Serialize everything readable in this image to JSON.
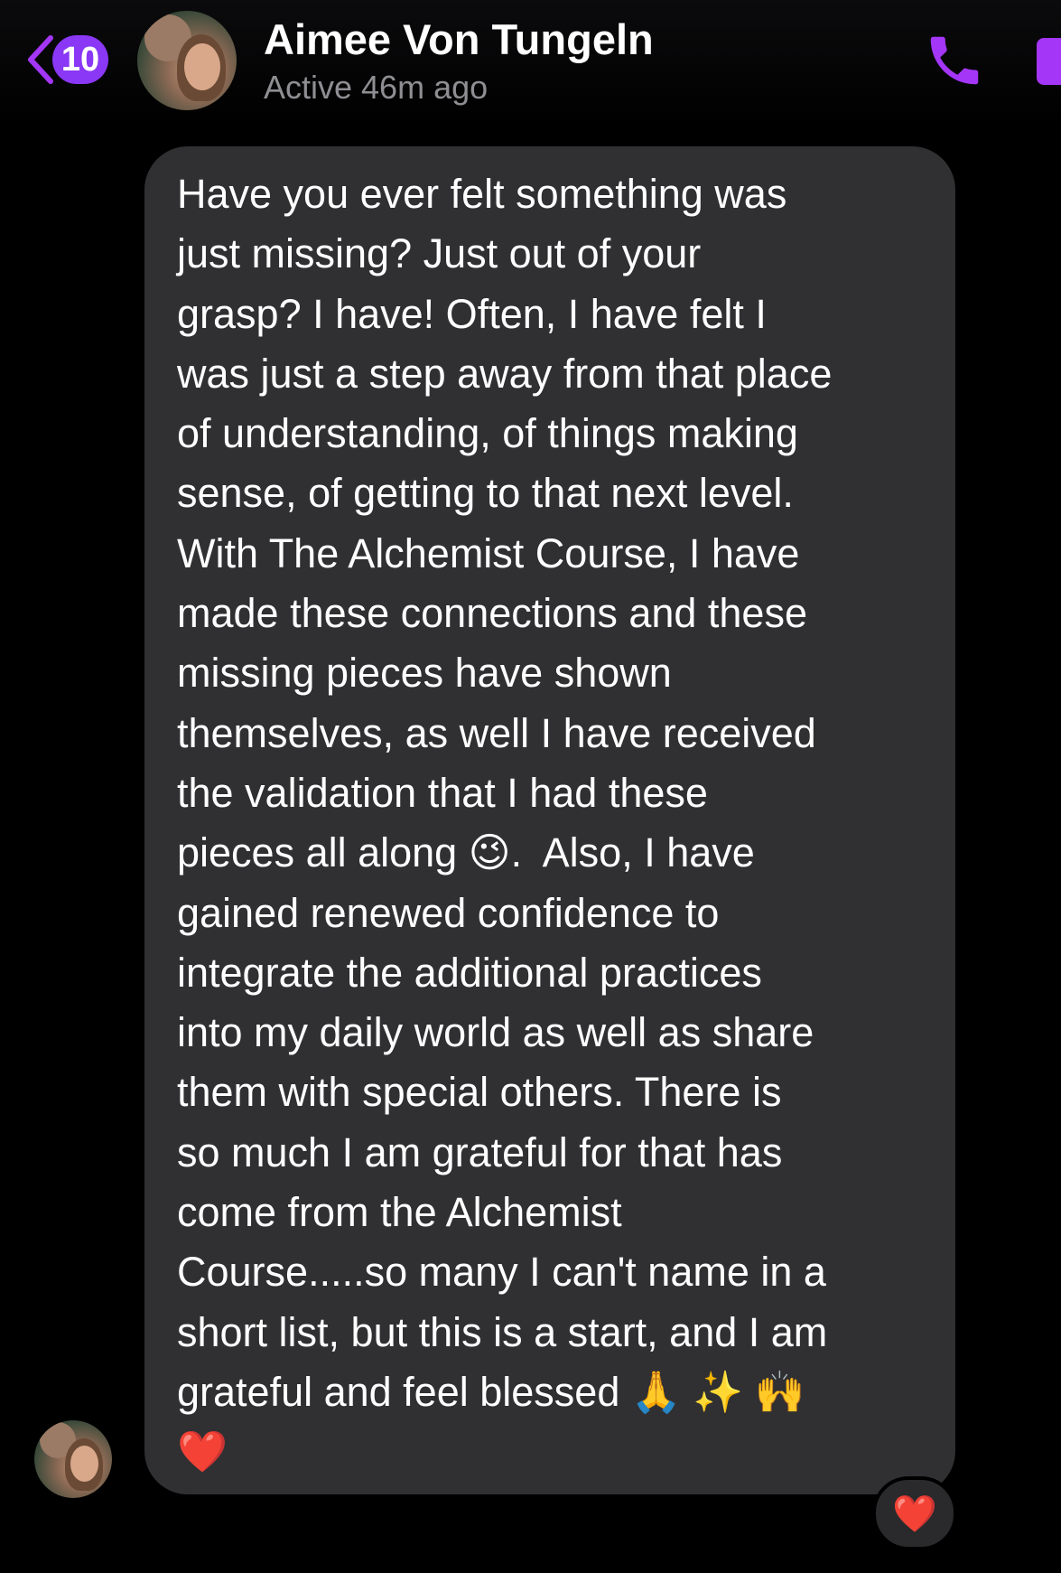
{
  "header": {
    "unread_count": "10",
    "contact_name": "Aimee Von Tungeln",
    "status": "Active 46m ago"
  },
  "colors": {
    "accent": "#a436f7",
    "badge": "#8a38f5",
    "bubble": "#303032",
    "background": "#000000",
    "status_text": "#8e8e93"
  },
  "icons": {
    "back": "chevron-left-icon",
    "call": "phone-icon",
    "video": "video-camera-icon"
  },
  "message": {
    "text": "Have you ever felt something was\njust missing? Just out of your\ngrasp? I have! Often, I have felt I\nwas just a step away from that place\nof understanding, of things making\nsense, of getting to that next level.\nWith The Alchemist Course, I have\nmade these connections and these\nmissing pieces have shown\nthemselves, as well I have received\nthe validation that I had these\npieces all along 😉.  Also, I have\ngained renewed confidence to\nintegrate the additional practices\ninto my daily world as well as share\nthem with special others. There is\nso much I am grateful for that has\ncome from the Alchemist\nCourse.....so many I can't name in a\nshort list, but this is a start, and I am\ngrateful and feel blessed 🙏 ✨ 🙌\n❤️",
    "reaction": "❤️"
  }
}
